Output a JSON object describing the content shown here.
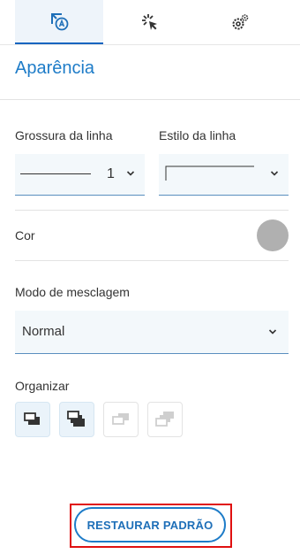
{
  "tabs": [
    {
      "icon": "appearance-icon",
      "active": true
    },
    {
      "icon": "click-icon",
      "active": false
    },
    {
      "icon": "settings-gear-icon",
      "active": false
    }
  ],
  "section_title": "Aparência",
  "line_thickness": {
    "label": "Grossura da linha",
    "value": "1"
  },
  "line_style": {
    "label": "Estilo da linha"
  },
  "color": {
    "label": "Cor",
    "value": "#b0b0b0"
  },
  "blend_mode": {
    "label": "Modo de mesclagem",
    "value": "Normal"
  },
  "arrange": {
    "label": "Organizar",
    "buttons": [
      {
        "icon": "bring-to-front-icon",
        "enabled": true
      },
      {
        "icon": "bring-forward-icon",
        "enabled": true
      },
      {
        "icon": "send-backward-icon",
        "enabled": false
      },
      {
        "icon": "send-to-back-icon",
        "enabled": false
      }
    ]
  },
  "restore_button": "RESTAURAR PADRÃO",
  "colors": {
    "accent": "#1e7cc8",
    "highlight": "#e01010"
  }
}
